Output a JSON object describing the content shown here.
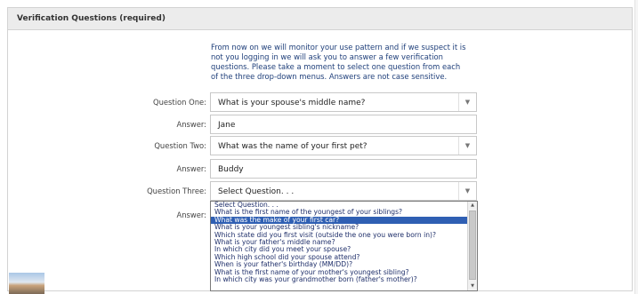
{
  "panel": {
    "title": "Verification Questions (required)"
  },
  "intro": "From now on we will monitor your use pattern and if we suspect it is not you logging in we will ask you to answer a few verification questions. Please take a moment to select one question from each of the three drop-down menus. Answers are not case sensitive.",
  "form": {
    "q1_label": "Question One:",
    "q1_value": "What is your spouse's middle name?",
    "a1_label": "Answer:",
    "a1_value": "Jane",
    "q2_label": "Question Two:",
    "q2_value": "What was the name of your first pet?",
    "a2_label": "Answer:",
    "a2_value": "Buddy",
    "q3_label": "Question Three:",
    "q3_value": "Select Question. . .",
    "a3_label": "Answer:"
  },
  "dropdown": {
    "options": [
      "Select Question. . .",
      "What is the first name of the youngest of your siblings?",
      "What was the make of your first car?",
      "What is your youngest sibling's nickname?",
      "Which state did you first visit (outside the one you were born in)?",
      "What is your father's middle name?",
      "In which city did you meet your spouse?",
      "Which high school did your spouse attend?",
      "When is your father's birthday (MM/DD)?",
      "What is the first name of your mother's youngest sibling?",
      "In which city was your grandmother born (father's mother)?"
    ],
    "highlighted": "What was the make of your first car?"
  },
  "icons": {
    "arrow": "chevron-down-icon",
    "scroll_up": "scroll-up-icon",
    "scroll_down": "scroll-down-icon"
  }
}
